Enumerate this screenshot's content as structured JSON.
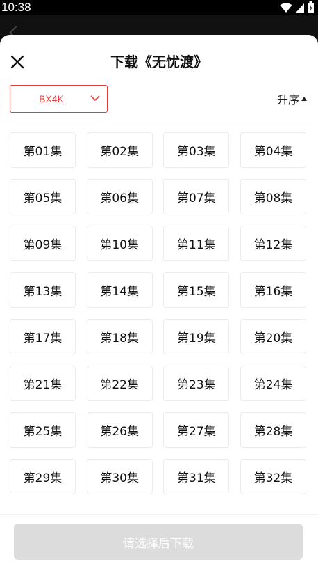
{
  "status_bar": {
    "time": "10:38"
  },
  "sheet": {
    "title": "下载《无忧渡》"
  },
  "toolbar": {
    "quality": "BX4K",
    "sort_label": "升序"
  },
  "episodes": [
    "第01集",
    "第02集",
    "第03集",
    "第04集",
    "第05集",
    "第06集",
    "第07集",
    "第08集",
    "第09集",
    "第10集",
    "第11集",
    "第12集",
    "第13集",
    "第14集",
    "第15集",
    "第16集",
    "第17集",
    "第18集",
    "第19集",
    "第20集",
    "第21集",
    "第22集",
    "第23集",
    "第24集",
    "第25集",
    "第26集",
    "第27集",
    "第28集",
    "第29集",
    "第30集",
    "第31集",
    "第32集"
  ],
  "footer": {
    "download_label": "请选择后下载"
  },
  "colors": {
    "accent": "#e53935",
    "disabled_button": "#dcdcdc"
  },
  "icons": {
    "close": "close-icon",
    "chevron": "chevron-down-icon",
    "sort": "sort-up-icon"
  }
}
